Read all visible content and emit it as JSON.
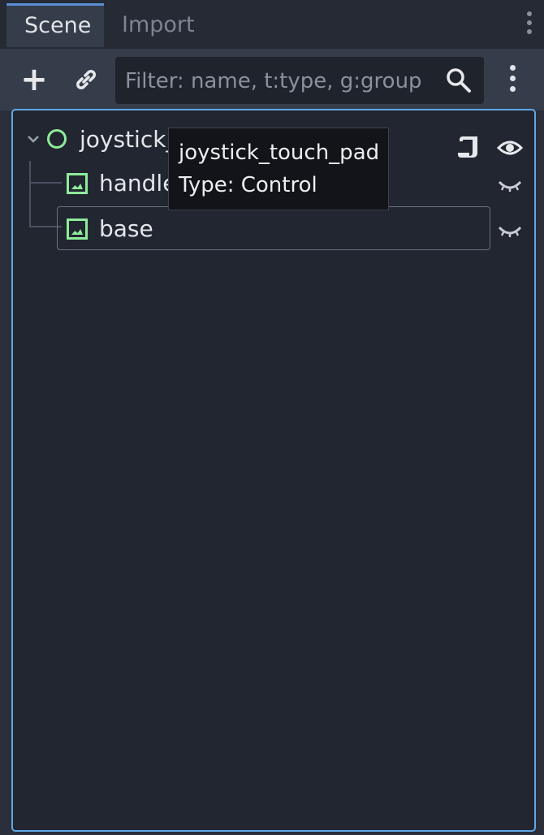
{
  "tabs": [
    {
      "label": "Scene",
      "active": true
    },
    {
      "label": "Import",
      "active": false
    }
  ],
  "toolbar": {
    "add_label": "+",
    "filter_placeholder": "Filter: name, t:type, g:group",
    "filter_value": ""
  },
  "tree": {
    "root": {
      "label": "joystick_",
      "icon": "control-node-icon",
      "expanded": true
    },
    "children": [
      {
        "label": "handle",
        "icon": "texture-rect-icon"
      },
      {
        "label": "base",
        "icon": "texture-rect-icon",
        "selected": true
      }
    ]
  },
  "tooltip": {
    "name": "joystick_touch_pad",
    "type": "Type: Control"
  },
  "colors": {
    "accent": "#5fa8e8",
    "node_green": "#8eeb9a",
    "panel_bg": "#212630"
  }
}
